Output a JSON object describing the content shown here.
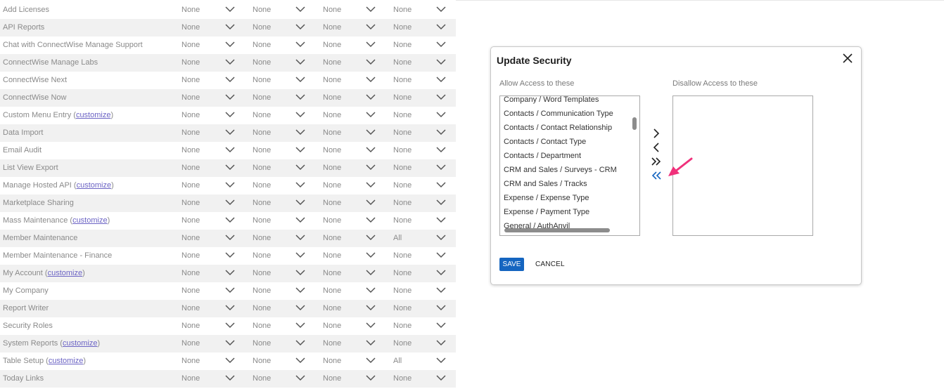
{
  "grid": {
    "rows": [
      {
        "label": "Add Licenses",
        "values": [
          "None",
          "None",
          "None",
          "None"
        ]
      },
      {
        "label": "API Reports",
        "values": [
          "None",
          "None",
          "None",
          "None"
        ]
      },
      {
        "label": "Chat with ConnectWise Manage Support",
        "values": [
          "None",
          "None",
          "None",
          "None"
        ]
      },
      {
        "label": "ConnectWise Manage Labs",
        "values": [
          "None",
          "None",
          "None",
          "None"
        ]
      },
      {
        "label": "ConnectWise Next",
        "values": [
          "None",
          "None",
          "None",
          "None"
        ]
      },
      {
        "label": "ConnectWise Now",
        "values": [
          "None",
          "None",
          "None",
          "None"
        ]
      },
      {
        "label": "Custom Menu Entry",
        "link": "customize",
        "values": [
          "None",
          "None",
          "None",
          "None"
        ]
      },
      {
        "label": "Data Import",
        "values": [
          "None",
          "None",
          "None",
          "None"
        ]
      },
      {
        "label": "Email Audit",
        "values": [
          "None",
          "None",
          "None",
          "None"
        ]
      },
      {
        "label": "List View Export",
        "values": [
          "None",
          "None",
          "None",
          "None"
        ]
      },
      {
        "label": "Manage Hosted API",
        "link": "customize",
        "values": [
          "None",
          "None",
          "None",
          "None"
        ]
      },
      {
        "label": "Marketplace Sharing",
        "values": [
          "None",
          "None",
          "None",
          "None"
        ]
      },
      {
        "label": "Mass Maintenance",
        "link": "customize",
        "values": [
          "None",
          "None",
          "None",
          "None"
        ]
      },
      {
        "label": "Member Maintenance",
        "values": [
          "None",
          "None",
          "None",
          "All"
        ]
      },
      {
        "label": "Member Maintenance - Finance",
        "values": [
          "None",
          "None",
          "None",
          "None"
        ]
      },
      {
        "label": "My Account",
        "link": "customize",
        "values": [
          "None",
          "None",
          "None",
          "None"
        ]
      },
      {
        "label": "My Company",
        "values": [
          "None",
          "None",
          "None",
          "None"
        ]
      },
      {
        "label": "Report Writer",
        "values": [
          "None",
          "None",
          "None",
          "None"
        ]
      },
      {
        "label": "Security Roles",
        "values": [
          "None",
          "None",
          "None",
          "None"
        ]
      },
      {
        "label": "System Reports",
        "link": "customize",
        "values": [
          "None",
          "None",
          "None",
          "None"
        ]
      },
      {
        "label": "Table Setup",
        "link": "customize",
        "values": [
          "None",
          "None",
          "None",
          "All"
        ]
      },
      {
        "label": "Today Links",
        "values": [
          "None",
          "None",
          "None",
          "None"
        ]
      }
    ]
  },
  "modal": {
    "title": "Update Security",
    "allow_label": "Allow Access to these",
    "disallow_label": "Disallow Access to these",
    "allow_items": [
      "Company / Word Templates",
      "Contacts / Communication Type",
      "Contacts / Contact Relationship",
      "Contacts / Contact Type",
      "Contacts / Department",
      "CRM and Sales / Surveys - CRM",
      "CRM and Sales / Tracks",
      "Expense / Expense Type",
      "Expense / Payment Type",
      "General / AuthAnvil"
    ],
    "disallow_items": [],
    "move_buttons": [
      "move-right-icon",
      "move-left-icon",
      "move-all-right-icon",
      "move-all-left-icon"
    ],
    "save_label": "Save",
    "cancel_label": "Cancel",
    "close_icon": "close-icon"
  },
  "colors": {
    "link": "#6b63c4",
    "save_button": "#1565c0",
    "active_move_button": "#1565c0",
    "annotation_arrow": "#f0317b",
    "alt_row": "#f1f1f1"
  }
}
